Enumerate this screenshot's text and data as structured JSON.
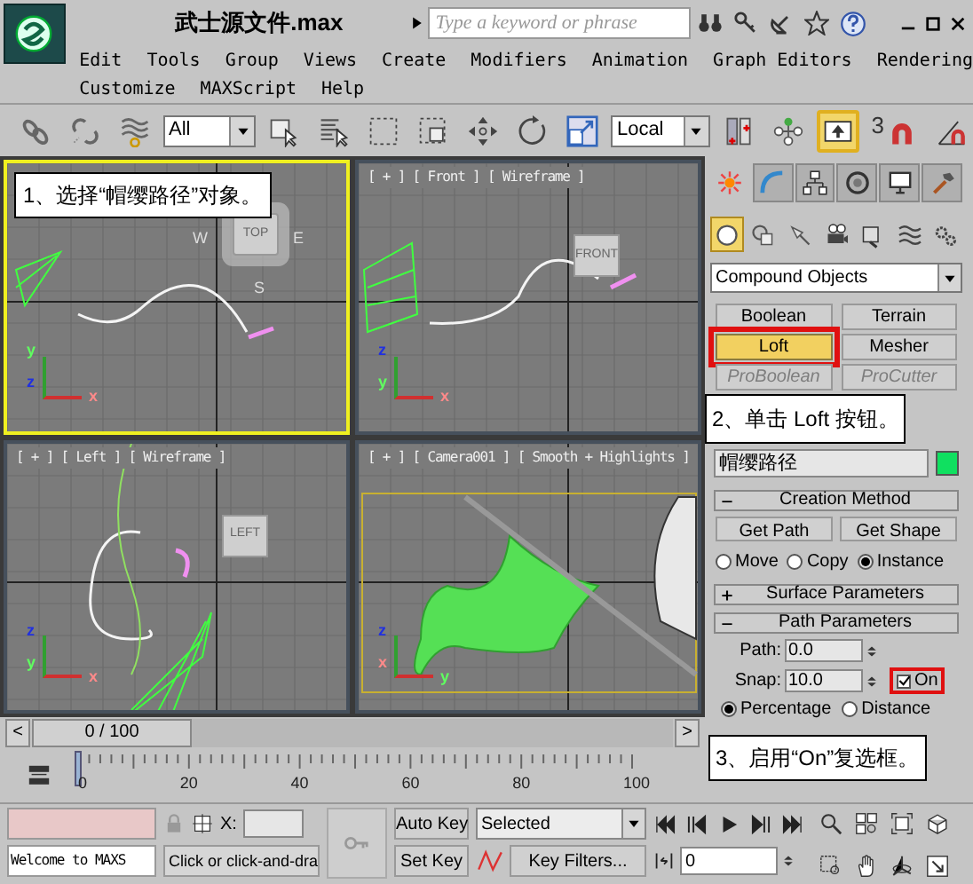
{
  "title_bar": {
    "file_name": "武士源文件.max",
    "search": {
      "placeholder": "Type a keyword or phrase"
    }
  },
  "menu_rows": [
    [
      "Edit",
      "Tools",
      "Group",
      "Views",
      "Create",
      "Modifiers",
      "Animation",
      "Graph Editors",
      "Rendering"
    ],
    [
      "Customize",
      "MAXScript",
      "Help"
    ]
  ],
  "toolbar": [
    {
      "kind": "link",
      "selected": false
    },
    {
      "kind": "unlink",
      "selected": false
    },
    {
      "kind": "bind",
      "selected": false
    },
    {
      "kind": "dropdown",
      "value": "All",
      "selected": false
    },
    {
      "kind": "select",
      "selected": false
    },
    {
      "kind": "select_by_name",
      "selected": false
    },
    {
      "kind": "region",
      "selected": false
    },
    {
      "kind": "crossing",
      "selected": false
    },
    {
      "kind": "move",
      "selected": false
    },
    {
      "kind": "rotate",
      "selected": false
    },
    {
      "kind": "scale",
      "selected": false
    },
    {
      "kind": "dropdown",
      "value": "Local",
      "selected": false
    },
    {
      "kind": "pivot",
      "selected": false
    },
    {
      "kind": "manipulate",
      "selected": false
    },
    {
      "kind": "override",
      "selected": true
    },
    {
      "kind": "snap",
      "label": "3",
      "selected": false
    },
    {
      "kind": "angle_snap",
      "selected": false
    }
  ],
  "viewports": [
    {
      "kind": "top",
      "selected": true,
      "viewcube": "TOP",
      "compass": [
        "W",
        "E",
        "S"
      ],
      "axes": [
        "y",
        "z",
        "x"
      ]
    },
    {
      "kind": "front",
      "label": "[ + ] [ Front ] [ Wireframe ]",
      "selected": false,
      "viewcube": "FRONT",
      "axes": [
        "z",
        "y",
        "x"
      ]
    },
    {
      "kind": "left",
      "label": "[ + ] [ Left ] [ Wireframe ]",
      "selected": false,
      "viewcube": "LEFT",
      "axes": [
        "z",
        "y",
        "x"
      ]
    },
    {
      "kind": "camera",
      "label": "[ + ] [ Camera001 ] [ Smooth + Highlights ]",
      "selected": false,
      "axes": [
        "z",
        "x",
        "y"
      ]
    }
  ],
  "callouts": [
    {
      "text": "1、选择“帽缨路径”对象。"
    },
    {
      "text": "2、单击 Loft 按钮。"
    },
    {
      "text": "3、启用“On”复选框。"
    }
  ],
  "command_panel": {
    "tabs": [
      {
        "kind": "create",
        "selected": true
      },
      {
        "kind": "modify",
        "selected": false
      },
      {
        "kind": "hierarchy",
        "selected": false
      },
      {
        "kind": "motion",
        "selected": false
      },
      {
        "kind": "display",
        "selected": false
      },
      {
        "kind": "utilities",
        "selected": false
      }
    ],
    "categories": [
      {
        "kind": "geometry",
        "selected": true
      },
      {
        "kind": "shapes",
        "selected": false
      },
      {
        "kind": "lights",
        "selected": false
      },
      {
        "kind": "cameras",
        "selected": false
      },
      {
        "kind": "helpers",
        "selected": false
      },
      {
        "kind": "spacewarps",
        "selected": false
      },
      {
        "kind": "systems",
        "selected": false
      }
    ],
    "object_category": "Compound Objects",
    "object_types": [
      {
        "label": "Boolean",
        "selected": false,
        "disabled": false,
        "highlighted": false
      },
      {
        "label": "Terrain",
        "selected": false,
        "disabled": false,
        "highlighted": false
      },
      {
        "label": "Loft",
        "selected": true,
        "disabled": false,
        "highlighted": true
      },
      {
        "label": "Mesher",
        "selected": false,
        "disabled": false,
        "highlighted": false
      },
      {
        "label": "ProBoolean",
        "selected": false,
        "disabled": true,
        "highlighted": false
      },
      {
        "label": "ProCutter",
        "selected": false,
        "disabled": true,
        "highlighted": false
      }
    ],
    "name_field": {
      "value": "帽缨路径",
      "color": "#10e060"
    },
    "creation_method": {
      "title": "Creation Method",
      "expanded": true,
      "buttons": [
        "Get Path",
        "Get Shape"
      ],
      "radios": [
        {
          "label": "Move",
          "selected": false
        },
        {
          "label": "Copy",
          "selected": false
        },
        {
          "label": "Instance",
          "selected": true
        }
      ]
    },
    "surface_parameters": {
      "title": "Surface Parameters",
      "expanded": false
    },
    "path_parameters": {
      "title": "Path Parameters",
      "expanded": true,
      "fields": [
        {
          "label": "Path:",
          "value": "0.0"
        },
        {
          "label": "Snap:",
          "value": "10.0"
        }
      ],
      "snap_toggle": {
        "label": "On",
        "checked": true,
        "highlighted": true
      },
      "radios": [
        {
          "label": "Percentage",
          "selected": true
        },
        {
          "label": "Distance",
          "selected": false
        }
      ]
    }
  },
  "timeline": {
    "prev": "<",
    "position": "0 / 100",
    "level": 0,
    "next": ">",
    "ticks": [
      "0",
      "20",
      "40",
      "60",
      "80",
      "100"
    ]
  },
  "status_bar": {
    "listener": "Welcome to MAXS",
    "x_label": "X:",
    "prompt": "Click or click-and-dra",
    "auto_key": "Auto Key",
    "key_mode": "Selected",
    "set_key": "Set Key",
    "key_filters": "Key Filters...",
    "frame": "0"
  }
}
